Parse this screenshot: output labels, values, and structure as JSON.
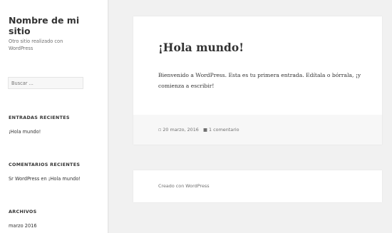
{
  "site": {
    "title": "Nombre de mi sitio",
    "description": "Otro sitio realizado con WordPress"
  },
  "search": {
    "placeholder": "Buscar ..."
  },
  "widgets": {
    "recent_posts": {
      "title": "ENTRADAS RECIENTES",
      "items": [
        "¡Hola mundo!"
      ]
    },
    "recent_comments": {
      "title": "COMENTARIOS RECIENTES",
      "author": "Sr WordPress",
      "connector": "en",
      "post": "¡Hola mundo!"
    },
    "archives": {
      "title": "ARCHIVOS",
      "items": [
        "marzo 2016"
      ]
    }
  },
  "post": {
    "title": "¡Hola mundo!",
    "content": "Bienvenido a WordPress. Esta es tu primera entrada. Edítala o bórrala, ¡y comienza a escribir!",
    "date": "20 marzo, 2016",
    "comments": "1 comentario"
  },
  "footer": {
    "credit": "Creado con WordPress"
  }
}
